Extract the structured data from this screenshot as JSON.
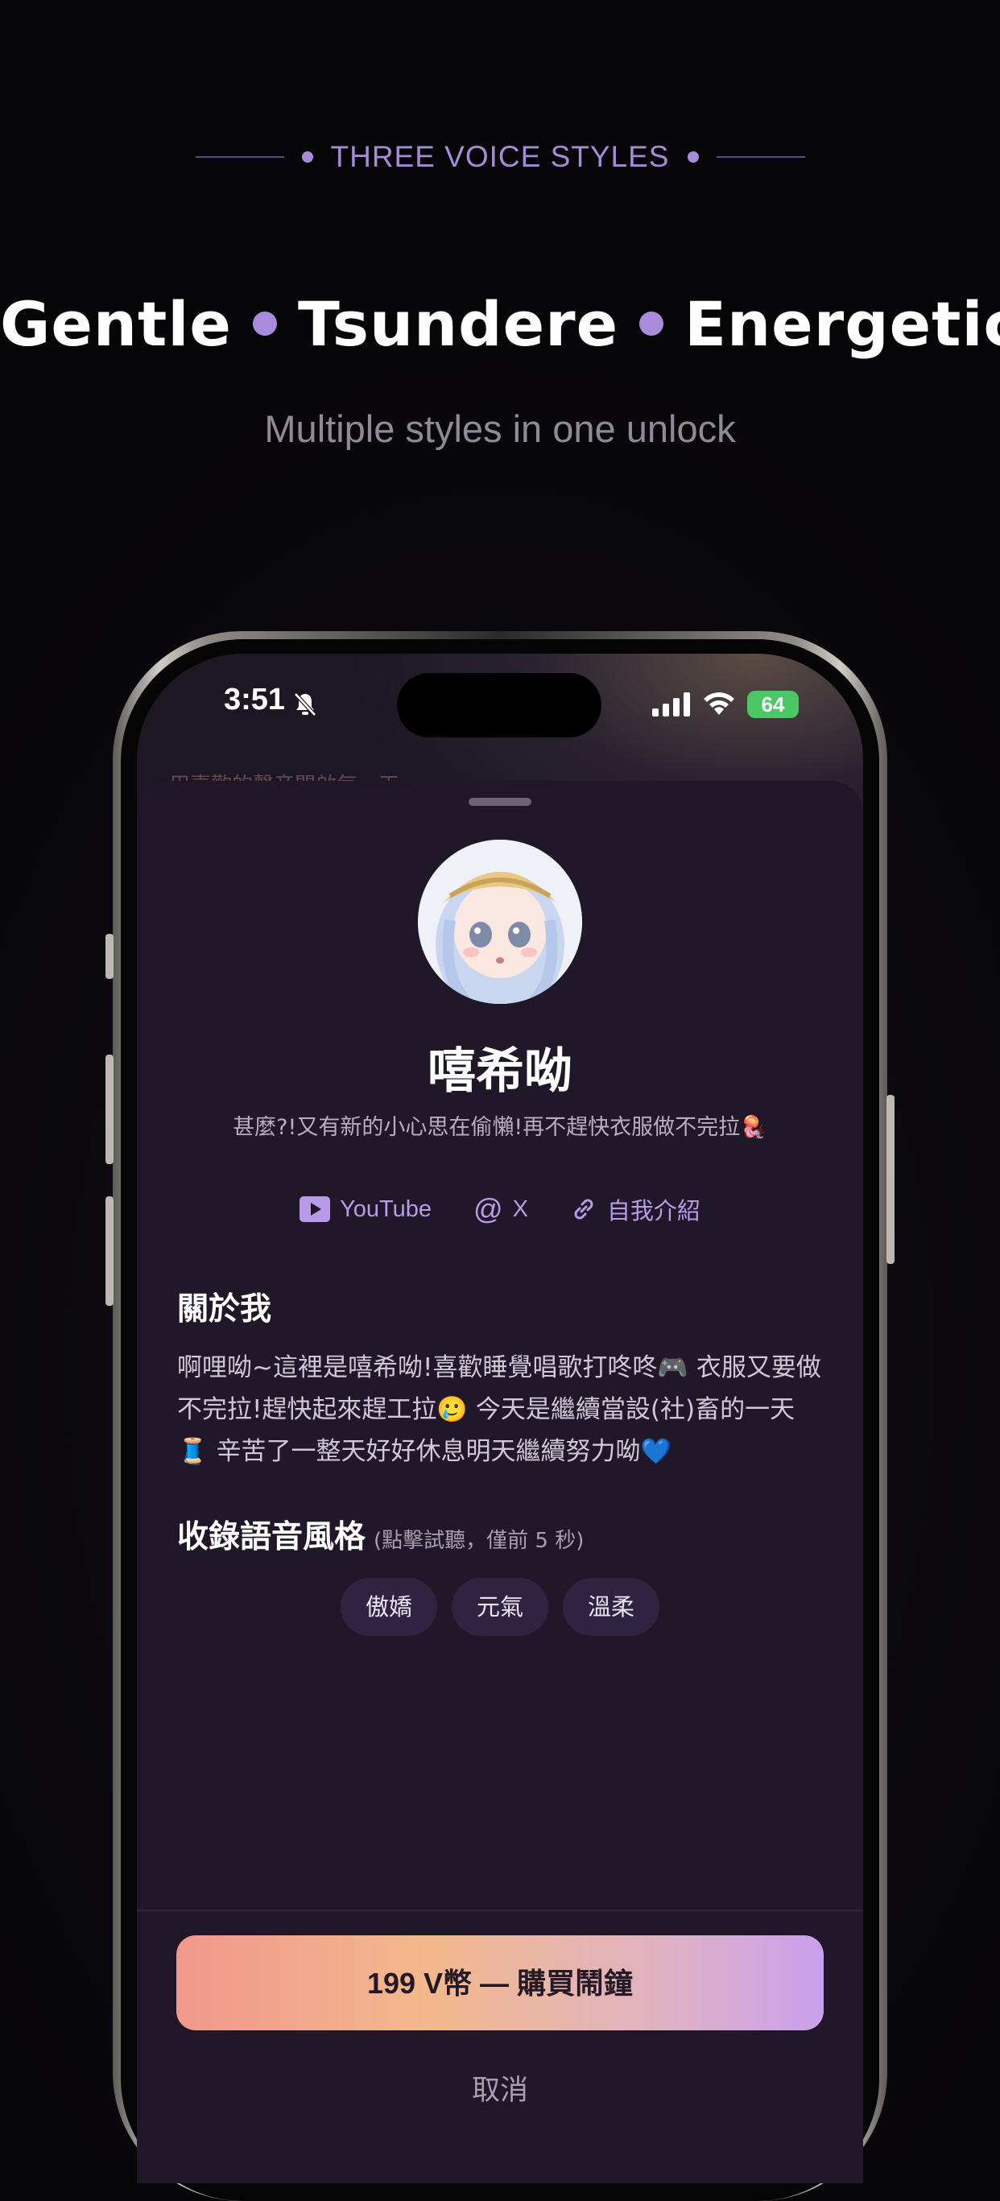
{
  "header": {
    "eyebrow": "THREE VOICE STYLES",
    "styles": [
      "Gentle",
      "Tsundere",
      "Energetic"
    ],
    "subtitle": "Multiple styles in one unlock"
  },
  "status_bar": {
    "time": "3:51",
    "battery": "64"
  },
  "background_text": "用喜歡的聲音開啟每一天",
  "profile": {
    "name": "嘻希呦",
    "bio": "甚麼?!又有新的小心思在偷懶!再不趕快衣服做不完拉🪼",
    "links": [
      {
        "icon": "youtube-icon",
        "label": "YouTube"
      },
      {
        "icon": "at-icon",
        "label": "X"
      },
      {
        "icon": "link-icon",
        "label": "自我介紹"
      }
    ]
  },
  "about": {
    "heading": "關於我",
    "text": "啊哩呦~這裡是嘻希呦!喜歡睡覺唱歌打咚咚🎮 衣服又要做不完拉!趕快起來趕工拉🥲 今天是繼續當設(社)畜的一天🧵 辛苦了一整天好好休息明天繼續努力呦💙"
  },
  "voices": {
    "heading": "收錄語音風格",
    "note": "(點擊試聽，僅前 5 秒)",
    "chips": [
      "傲嬌",
      "元氣",
      "溫柔"
    ]
  },
  "actions": {
    "buy_label": "199 V幣 — 購買鬧鐘",
    "cancel_label": "取消"
  },
  "colors": {
    "accent": "#a88bdc",
    "sheet_bg": "#201828",
    "chip_bg": "#2e2340"
  }
}
